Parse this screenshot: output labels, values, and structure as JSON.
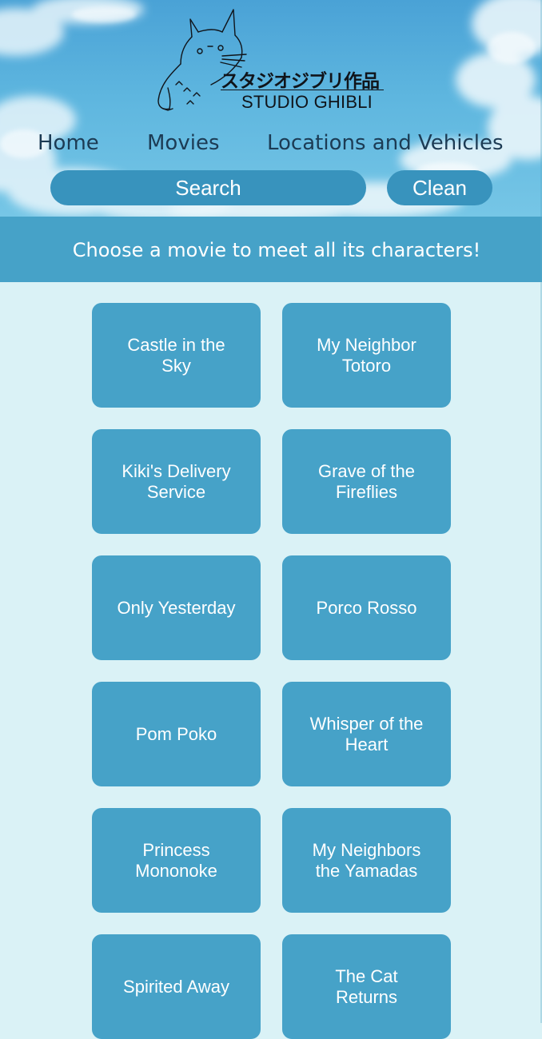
{
  "colors": {
    "header_sky": "#5eb6df",
    "banner": "#46a2c8",
    "card": "#46a2c8",
    "page_background": "#daf2f6",
    "search_field": "#3893bd",
    "nav_text": "#1c3b54"
  },
  "header": {
    "logo_icon": "totoro-icon",
    "logo_japanese": "スタジオジブリ作品",
    "logo_english": "STUDIO GHIBLI"
  },
  "nav": {
    "items": [
      {
        "label": "Home"
      },
      {
        "label": "Movies"
      },
      {
        "label": "Locations and Vehicles"
      }
    ]
  },
  "search": {
    "placeholder": "Search",
    "value": "",
    "clean_label": "Clean"
  },
  "banner": {
    "text": "Choose a movie to meet all its characters!"
  },
  "movies": [
    {
      "title": "Castle in the Sky"
    },
    {
      "title": "My Neighbor Totoro"
    },
    {
      "title": "Kiki's Delivery Service"
    },
    {
      "title": "Grave of the Fireflies"
    },
    {
      "title": "Only Yesterday"
    },
    {
      "title": "Porco Rosso"
    },
    {
      "title": "Pom Poko"
    },
    {
      "title": "Whisper of the Heart"
    },
    {
      "title": "Princess Mononoke"
    },
    {
      "title": "My Neighbors the Yamadas"
    },
    {
      "title": "Spirited Away"
    },
    {
      "title": "The Cat Returns"
    }
  ]
}
